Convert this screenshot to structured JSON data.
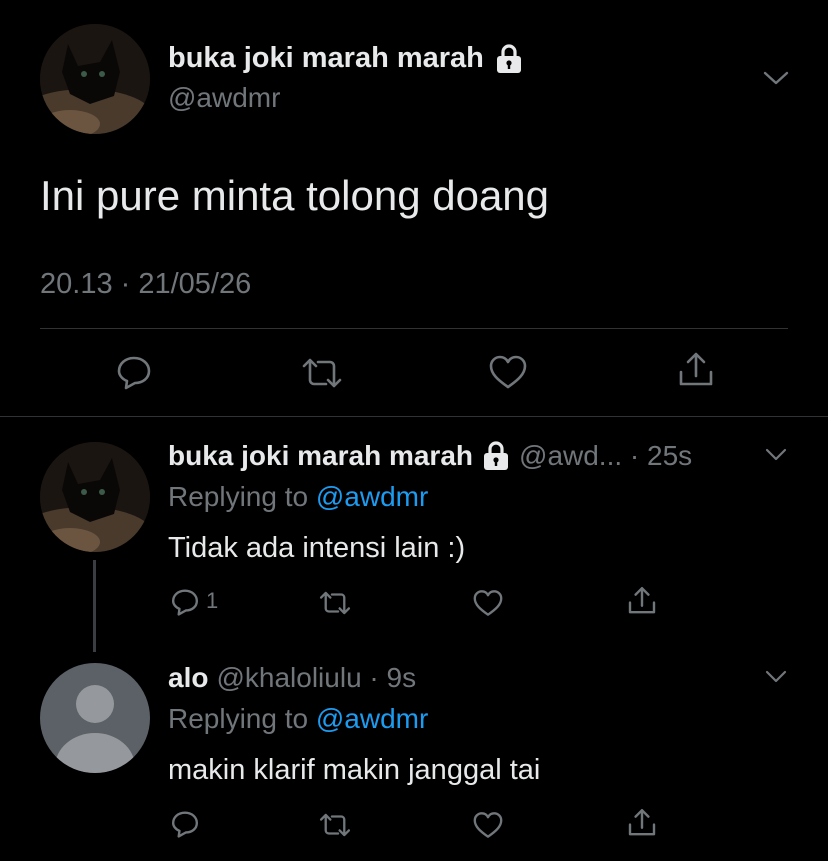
{
  "main_tweet": {
    "display_name": "buka joki marah marah",
    "handle": "@awdmr",
    "text": "Ini pure minta tolong doang",
    "timestamp": "20.13 · 21/05/26"
  },
  "replies": [
    {
      "display_name": "buka joki marah marah",
      "handle_time": "@awd... · 25s",
      "replying_prefix": "Replying to",
      "replying_to": "@awdmr",
      "text": "Tidak ada intensi lain :)",
      "reply_count": "1"
    },
    {
      "display_name": "alo",
      "handle_time": "@khaloliulu · 9s",
      "replying_prefix": "Replying to",
      "replying_to": "@awdmr",
      "text": "makin klarif makin janggal tai",
      "reply_count": ""
    }
  ],
  "colors": {
    "background": "#000000",
    "text": "#e7e9ea",
    "muted": "#71767b",
    "link": "#1d9bf0",
    "divider": "#2f3336"
  },
  "icons": [
    "chevron-down-icon",
    "lock-icon",
    "reply-icon",
    "retweet-icon",
    "like-icon",
    "share-icon",
    "default-avatar-icon"
  ]
}
